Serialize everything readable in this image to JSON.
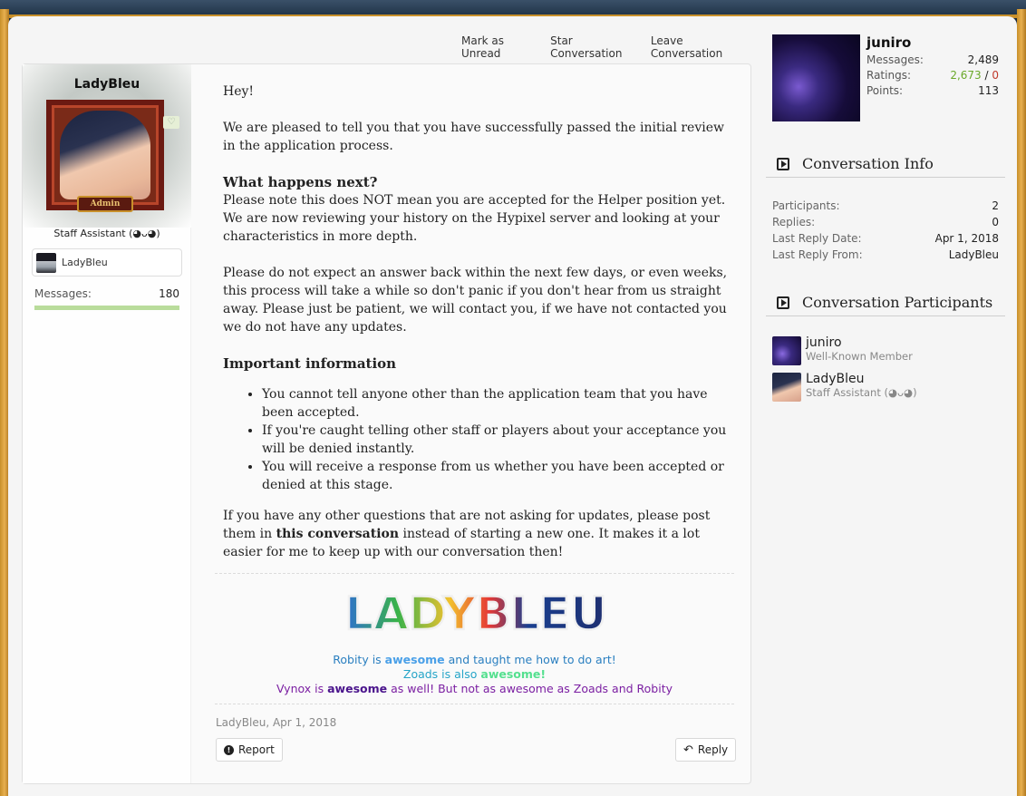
{
  "top_actions": {
    "mark_unread": "Mark as Unread",
    "star": "Star Conversation",
    "leave": "Leave Conversation"
  },
  "author": {
    "name": "LadyBleu",
    "badge": "Admin",
    "title": "Staff Assistant (◕ᴗ◕)",
    "banner_name": "LadyBleu",
    "messages_label": "Messages:",
    "messages_value": "180",
    "messages_progress": 1.0
  },
  "message": {
    "greeting": "Hey!",
    "p1": "We are pleased to tell you that you have successfully passed the initial review in the application process.",
    "h1": "What happens next?",
    "p2": "Please note this does NOT mean you are accepted for the Helper position yet. We are now reviewing your history on the Hypixel server and looking at your characteristics in more depth.",
    "p3": "Please do not expect an answer back within the next few days, or even weeks, this process will take a while so don't panic if you don't hear from us straight away. Please just be patient, we will contact you, if we have not contacted you we do not have any updates.",
    "h2": "Important information",
    "bullets": [
      "You cannot tell anyone other than the application team that you have been accepted.",
      "If you're caught telling other staff or players about your acceptance you will be denied instantly.",
      "You will receive a response from us whether you have been accepted or denied at this stage."
    ],
    "p4_pre": "If you have any other questions that are not asking for updates, please post them in ",
    "p4_bold": "this conversation",
    "p4_post": " instead of starting a new one. It makes it a lot easier for me to keep up with our conversation then!"
  },
  "signature": {
    "logo_text": "LADYBLEU",
    "l1_a": "Robity is ",
    "l1_b": "awesome",
    "l1_c": " and taught me how to do art!",
    "l2_a": "Zoads is also ",
    "l2_b": "awesome!",
    "l3_a": "Vynox is ",
    "l3_b": "awesome",
    "l3_c": " as well! But not as awesome as Zoads and Robity"
  },
  "post_meta": "LadyBleu, Apr 1, 2018",
  "buttons": {
    "report": "Report",
    "reply": "Reply"
  },
  "sidebar": {
    "user": {
      "name": "juniro",
      "messages_label": "Messages:",
      "messages": "2,489",
      "ratings_label": "Ratings:",
      "ratings_pos": "2,673",
      "ratings_sep": " / ",
      "ratings_neg": "0",
      "points_label": "Points:",
      "points": "113"
    },
    "info_heading": "Conversation Info",
    "info": [
      {
        "label": "Participants:",
        "value": "2"
      },
      {
        "label": "Replies:",
        "value": "0"
      },
      {
        "label": "Last Reply Date:",
        "value": "Apr 1, 2018"
      },
      {
        "label": "Last Reply From:",
        "value": "LadyBleu"
      }
    ],
    "participants_heading": "Conversation Participants",
    "participants": [
      {
        "name": "juniro",
        "role": "Well-Known Member"
      },
      {
        "name": "LadyBleu",
        "role": "Staff Assistant (◕ᴗ◕)"
      }
    ]
  },
  "colors": {
    "page_bg": "#f5f5f5",
    "frame_gold": "#c8902a",
    "progress_green": "#b9dc9b",
    "ratings_green": "#6aa82a"
  }
}
